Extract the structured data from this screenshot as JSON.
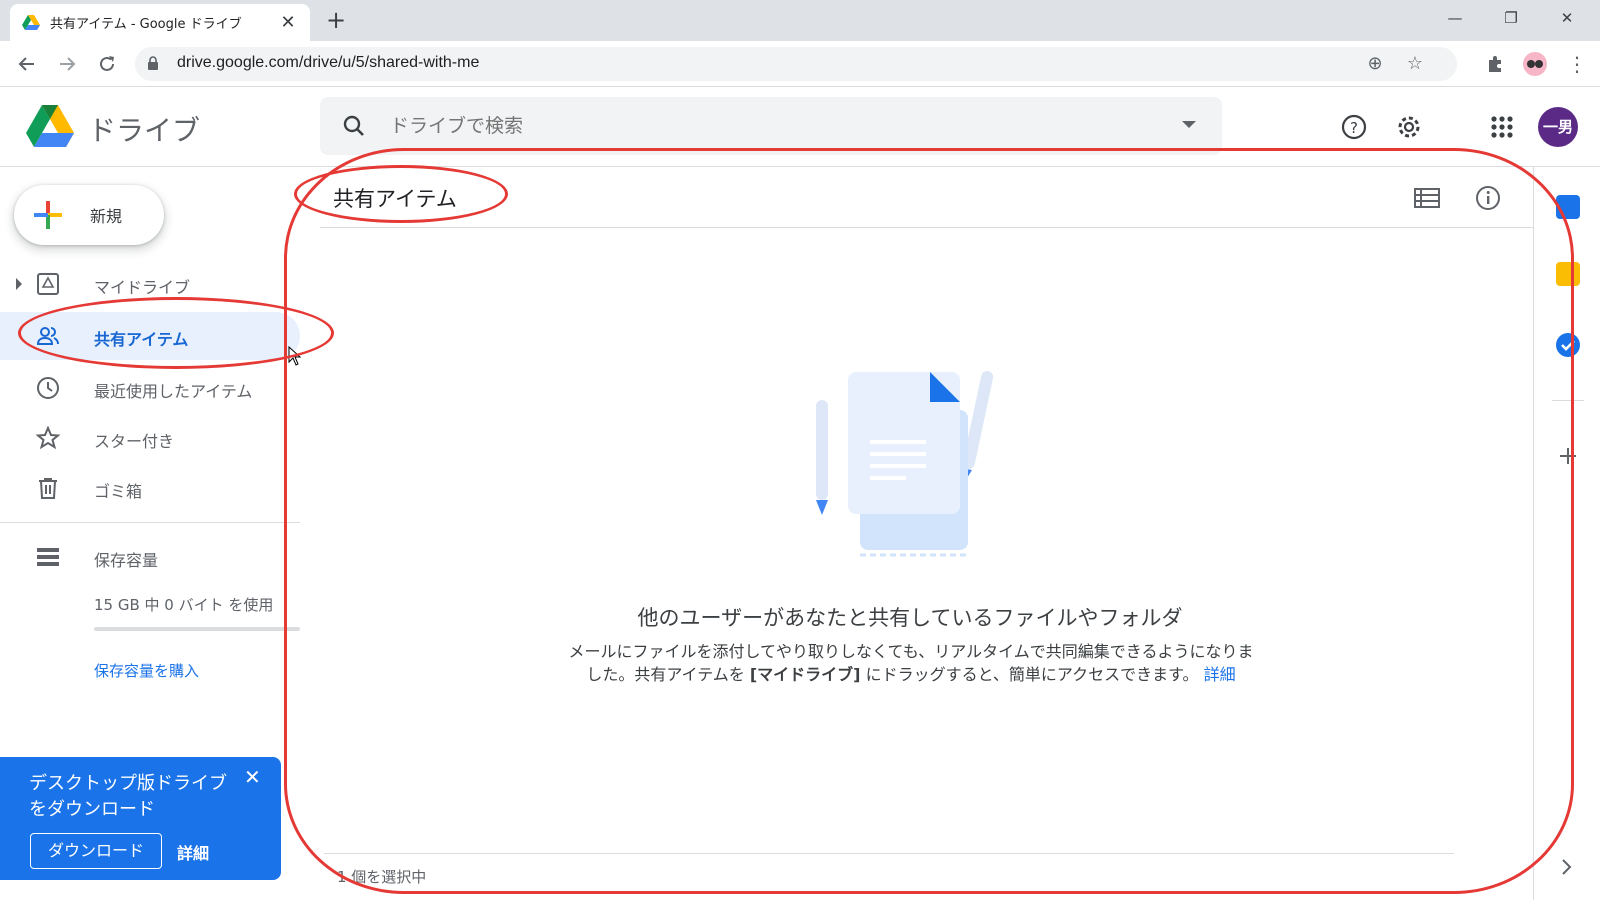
{
  "browser": {
    "tab_title": "共有アイテム - Google ドライブ",
    "tab_close": "✕",
    "new_tab": "+",
    "url": "drive.google.com/drive/u/5/shared-with-me",
    "window_controls": {
      "minimize": "—",
      "maximize": "❐",
      "close": "✕"
    }
  },
  "header": {
    "app_name": "ドライブ",
    "search_placeholder": "ドライブで検索",
    "avatar_text": "一男"
  },
  "sidebar": {
    "new_label": "新規",
    "items": [
      {
        "label": "マイドライブ",
        "icon": "my-drive-icon"
      },
      {
        "label": "共有アイテム",
        "icon": "shared-icon",
        "active": true
      },
      {
        "label": "最近使用したアイテム",
        "icon": "clock-icon"
      },
      {
        "label": "スター付き",
        "icon": "star-icon"
      },
      {
        "label": "ゴミ箱",
        "icon": "trash-icon"
      }
    ],
    "storage_label": "保存容量",
    "storage_usage": "15 GB 中 0 バイト を使用",
    "buy_storage": "保存容量を購入"
  },
  "promo": {
    "title": "デスクトップ版ドライブをダウンロード",
    "download_label": "ダウンロード",
    "detail_label": "詳細",
    "close": "✕"
  },
  "main": {
    "title": "共有アイテム",
    "empty_title": "他のユーザーがあなたと共有しているファイルやフォルダ",
    "empty_desc_part1": "メールにファイルを添付してやり取りしなくても、リアルタイムで共同編集できるようになりました。共有アイテムを ",
    "empty_desc_bold": "[マイドライブ]",
    "empty_desc_part2": " にドラッグすると、簡単にアクセスできます。",
    "empty_desc_link": "詳細",
    "selection_count": "1 個を選択中"
  },
  "colors": {
    "accent": "#1a73e8",
    "active_bg": "#e8f0fe",
    "annotation": "#e53935",
    "avatar_bg": "#5b2a86"
  }
}
